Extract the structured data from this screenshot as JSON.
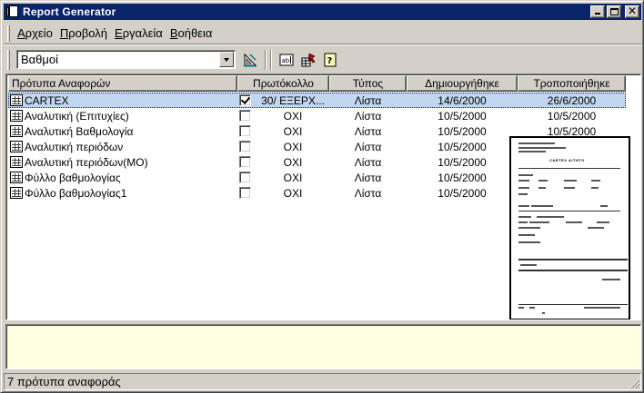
{
  "window": {
    "title": "Report Generator"
  },
  "menu": [
    {
      "pre": "",
      "acc": "Α",
      "post": "ρχείο"
    },
    {
      "pre": "",
      "acc": "Π",
      "post": "ροβολή"
    },
    {
      "pre": "",
      "acc": "Ε",
      "post": "ργαλεία"
    },
    {
      "pre": "",
      "acc": "Β",
      "post": "οήθεια"
    }
  ],
  "toolbar": {
    "combo_value": "Βαθμοί",
    "icons": [
      "design-icon",
      "text-field-icon",
      "query-icon",
      "help-icon"
    ]
  },
  "list": {
    "columns": [
      "Πρότυπα Αναφορών",
      "Πρωτόκολλο",
      "Τύπος",
      "Δημιουργήθηκε",
      "Τροποποιήθηκε"
    ],
    "rows": [
      {
        "name": "CARTEX",
        "checked": true,
        "protocol": "30/ ΕΞΕΡΧ...",
        "type": "Λίστα",
        "created": "14/6/2000",
        "modified": "26/6/2000",
        "selected": true
      },
      {
        "name": "Αναλυτική (Επιτυχίες)",
        "checked": false,
        "protocol": "ΟΧΙ",
        "type": "Λίστα",
        "created": "10/5/2000",
        "modified": "10/5/2000",
        "selected": false
      },
      {
        "name": "Αναλυτική Βαθμολογία",
        "checked": false,
        "protocol": "ΟΧΙ",
        "type": "Λίστα",
        "created": "10/5/2000",
        "modified": "10/5/2000",
        "selected": false
      },
      {
        "name": "Αναλυτική περιόδων",
        "checked": false,
        "protocol": "ΟΧΙ",
        "type": "Λίστα",
        "created": "10/5/2000",
        "modified": "",
        "selected": false
      },
      {
        "name": "Αναλυτική περιόδων(ΜΟ)",
        "checked": false,
        "protocol": "ΟΧΙ",
        "type": "Λίστα",
        "created": "10/5/2000",
        "modified": "",
        "selected": false
      },
      {
        "name": "Φύλλο βαθμολογίας",
        "checked": false,
        "protocol": "ΟΧΙ",
        "type": "Λίστα",
        "created": "10/5/2000",
        "modified": "",
        "selected": false
      },
      {
        "name": "Φύλλο βαθμολογίας1",
        "checked": false,
        "protocol": "ΟΧΙ",
        "type": "Λίστα",
        "created": "10/5/2000",
        "modified": "",
        "selected": false
      }
    ]
  },
  "preview": {
    "heading": "CARTEX ΑΙΤΗΤΟ"
  },
  "status": {
    "text": "7 πρότυπα αναφοράς"
  },
  "colors": {
    "titlebar": "#0a246a",
    "selection": "#c1d6ef",
    "description_bg": "#ffffe1"
  }
}
